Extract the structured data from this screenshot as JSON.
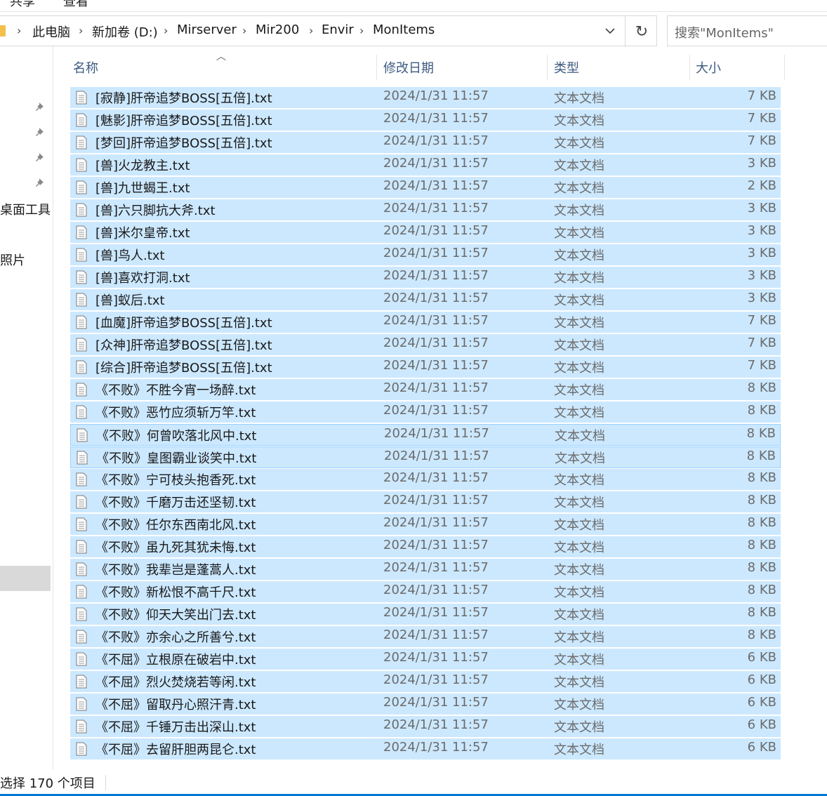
{
  "ribbon": {
    "tabs": [
      "共享",
      "查看"
    ]
  },
  "address": {
    "crumbs": [
      "此电脑",
      "新加卷 (D:)",
      "Mirserver",
      "Mir200",
      "Envir",
      "MonItems"
    ],
    "search_placeholder": "搜索\"MonItems\""
  },
  "nav": {
    "labels": [
      "桌面工具",
      "照片"
    ]
  },
  "columns": {
    "name": "名称",
    "date": "修改日期",
    "type": "类型",
    "size": "大小"
  },
  "files": [
    {
      "name": "[寂静]肝帝追梦BOSS[五倍].txt",
      "date": "2024/1/31 11:57",
      "type": "文本文档",
      "size": "7 KB"
    },
    {
      "name": "[魅影]肝帝追梦BOSS[五倍].txt",
      "date": "2024/1/31 11:57",
      "type": "文本文档",
      "size": "7 KB"
    },
    {
      "name": "[梦回]肝帝追梦BOSS[五倍].txt",
      "date": "2024/1/31 11:57",
      "type": "文本文档",
      "size": "7 KB"
    },
    {
      "name": "[兽]火龙教主.txt",
      "date": "2024/1/31 11:57",
      "type": "文本文档",
      "size": "3 KB"
    },
    {
      "name": "[兽]九世蝎王.txt",
      "date": "2024/1/31 11:57",
      "type": "文本文档",
      "size": "2 KB"
    },
    {
      "name": "[兽]六只脚抗大斧.txt",
      "date": "2024/1/31 11:57",
      "type": "文本文档",
      "size": "3 KB"
    },
    {
      "name": "[兽]米尔皇帝.txt",
      "date": "2024/1/31 11:57",
      "type": "文本文档",
      "size": "3 KB"
    },
    {
      "name": "[兽]鸟人.txt",
      "date": "2024/1/31 11:57",
      "type": "文本文档",
      "size": "3 KB"
    },
    {
      "name": "[兽]喜欢打洞.txt",
      "date": "2024/1/31 11:57",
      "type": "文本文档",
      "size": "3 KB"
    },
    {
      "name": "[兽]蚁后.txt",
      "date": "2024/1/31 11:57",
      "type": "文本文档",
      "size": "3 KB"
    },
    {
      "name": "[血魔]肝帝追梦BOSS[五倍].txt",
      "date": "2024/1/31 11:57",
      "type": "文本文档",
      "size": "7 KB"
    },
    {
      "name": "[众神]肝帝追梦BOSS[五倍].txt",
      "date": "2024/1/31 11:57",
      "type": "文本文档",
      "size": "7 KB"
    },
    {
      "name": "[综合]肝帝追梦BOSS[五倍].txt",
      "date": "2024/1/31 11:57",
      "type": "文本文档",
      "size": "7 KB"
    },
    {
      "name": "《不败》不胜今宵一场醉.txt",
      "date": "2024/1/31 11:57",
      "type": "文本文档",
      "size": "8 KB"
    },
    {
      "name": "《不败》恶竹应须斩万竿.txt",
      "date": "2024/1/31 11:57",
      "type": "文本文档",
      "size": "8 KB"
    },
    {
      "name": "《不败》何曾吹落北风中.txt",
      "date": "2024/1/31 11:57",
      "type": "文本文档",
      "size": "8 KB"
    },
    {
      "name": "《不败》皇图霸业谈笑中.txt",
      "date": "2024/1/31 11:57",
      "type": "文本文档",
      "size": "8 KB"
    },
    {
      "name": "《不败》宁可枝头抱香死.txt",
      "date": "2024/1/31 11:57",
      "type": "文本文档",
      "size": "8 KB"
    },
    {
      "name": "《不败》千磨万击还坚韧.txt",
      "date": "2024/1/31 11:57",
      "type": "文本文档",
      "size": "8 KB"
    },
    {
      "name": "《不败》任尔东西南北风.txt",
      "date": "2024/1/31 11:57",
      "type": "文本文档",
      "size": "8 KB"
    },
    {
      "name": "《不败》虽九死其犹未悔.txt",
      "date": "2024/1/31 11:57",
      "type": "文本文档",
      "size": "8 KB"
    },
    {
      "name": "《不败》我辈岂是蓬蒿人.txt",
      "date": "2024/1/31 11:57",
      "type": "文本文档",
      "size": "8 KB"
    },
    {
      "name": "《不败》新松恨不高千尺.txt",
      "date": "2024/1/31 11:57",
      "type": "文本文档",
      "size": "8 KB"
    },
    {
      "name": "《不败》仰天大笑出门去.txt",
      "date": "2024/1/31 11:57",
      "type": "文本文档",
      "size": "8 KB"
    },
    {
      "name": "《不败》亦余心之所善兮.txt",
      "date": "2024/1/31 11:57",
      "type": "文本文档",
      "size": "8 KB"
    },
    {
      "name": "《不屈》立根原在破岩中.txt",
      "date": "2024/1/31 11:57",
      "type": "文本文档",
      "size": "6 KB"
    },
    {
      "name": "《不屈》烈火焚烧若等闲.txt",
      "date": "2024/1/31 11:57",
      "type": "文本文档",
      "size": "6 KB"
    },
    {
      "name": "《不屈》留取丹心照汗青.txt",
      "date": "2024/1/31 11:57",
      "type": "文本文档",
      "size": "6 KB"
    },
    {
      "name": "《不屈》千锤万击出深山.txt",
      "date": "2024/1/31 11:57",
      "type": "文本文档",
      "size": "6 KB"
    },
    {
      "name": "《不屈》去留肝胆两昆仑.txt",
      "date": "2024/1/31 11:57",
      "type": "文本文档",
      "size": "6 KB"
    }
  ],
  "status": {
    "text": "选择 170 个项目"
  }
}
